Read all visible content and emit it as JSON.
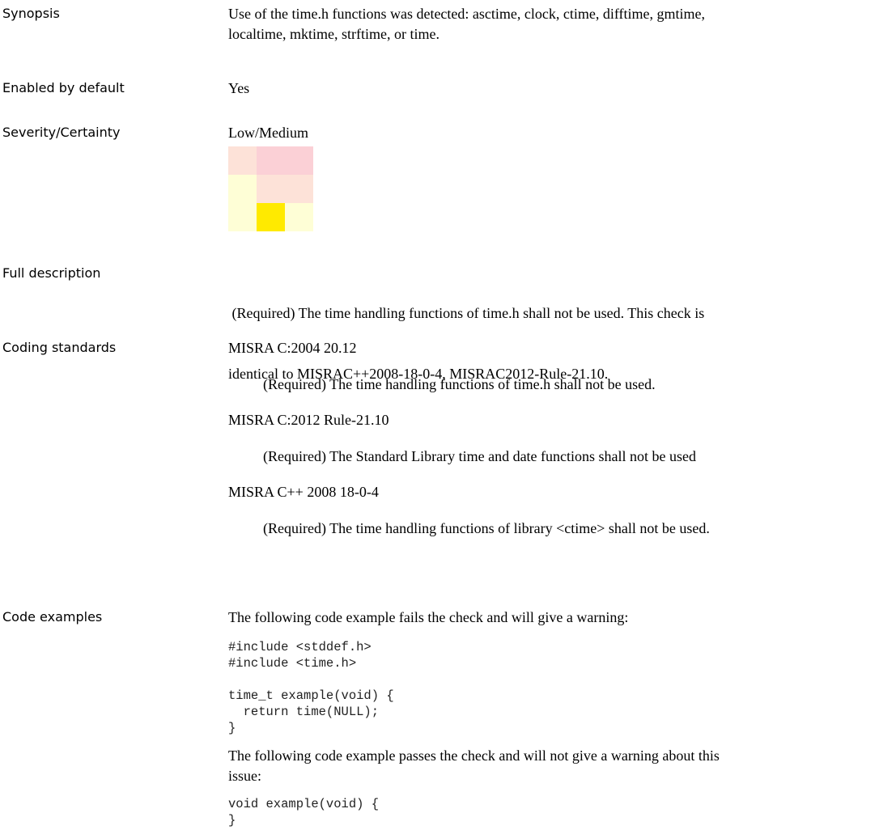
{
  "synopsis": {
    "label": "Synopsis",
    "line1": "Use of the time.h functions was detected: asctime, clock, ctime, difftime, gmtime,",
    "line2": "localtime, mktime, strftime, or time."
  },
  "enabled": {
    "label": "Enabled by default",
    "value": "Yes"
  },
  "severity": {
    "label": "Severity/Certainty",
    "value": "Low/Medium",
    "grid_colors": [
      [
        "#fde2d8",
        "#fbd0d6",
        "#fbd0d6"
      ],
      [
        "#fefed6",
        "#fde2d8",
        "#fde2d8"
      ],
      [
        "#fefed6",
        "#ffea00",
        "#fefed6"
      ]
    ]
  },
  "full_description": {
    "label": "Full description",
    "line1": " (Required) The time handling functions of time.h shall not be used. This check is",
    "line2": "identical to MISRAC++2008-18-0-4, MISRAC2012-Rule-21.10."
  },
  "coding_standards": {
    "label": "Coding standards",
    "items": [
      {
        "name": "MISRA C:2004 20.12",
        "text": "(Required) The time handling functions of time.h shall not be used."
      },
      {
        "name": "MISRA C:2012 Rule-21.10",
        "text": "(Required) The Standard Library time and date functions shall not be used"
      },
      {
        "name": "MISRA C++ 2008 18-0-4",
        "text": "(Required) The time handling functions of library <ctime> shall not be used."
      }
    ]
  },
  "code_examples": {
    "label": "Code examples",
    "fail_intro": "The following code example fails the check and will give a warning:",
    "fail_code": "#include <stddef.h>\n#include <time.h>\n\ntime_t example(void) {\n  return time(NULL);\n}",
    "pass_intro_line1": "The following code example passes the check and will not give a warning about this",
    "pass_intro_line2": "issue:",
    "pass_code": "void example(void) {\n}"
  }
}
